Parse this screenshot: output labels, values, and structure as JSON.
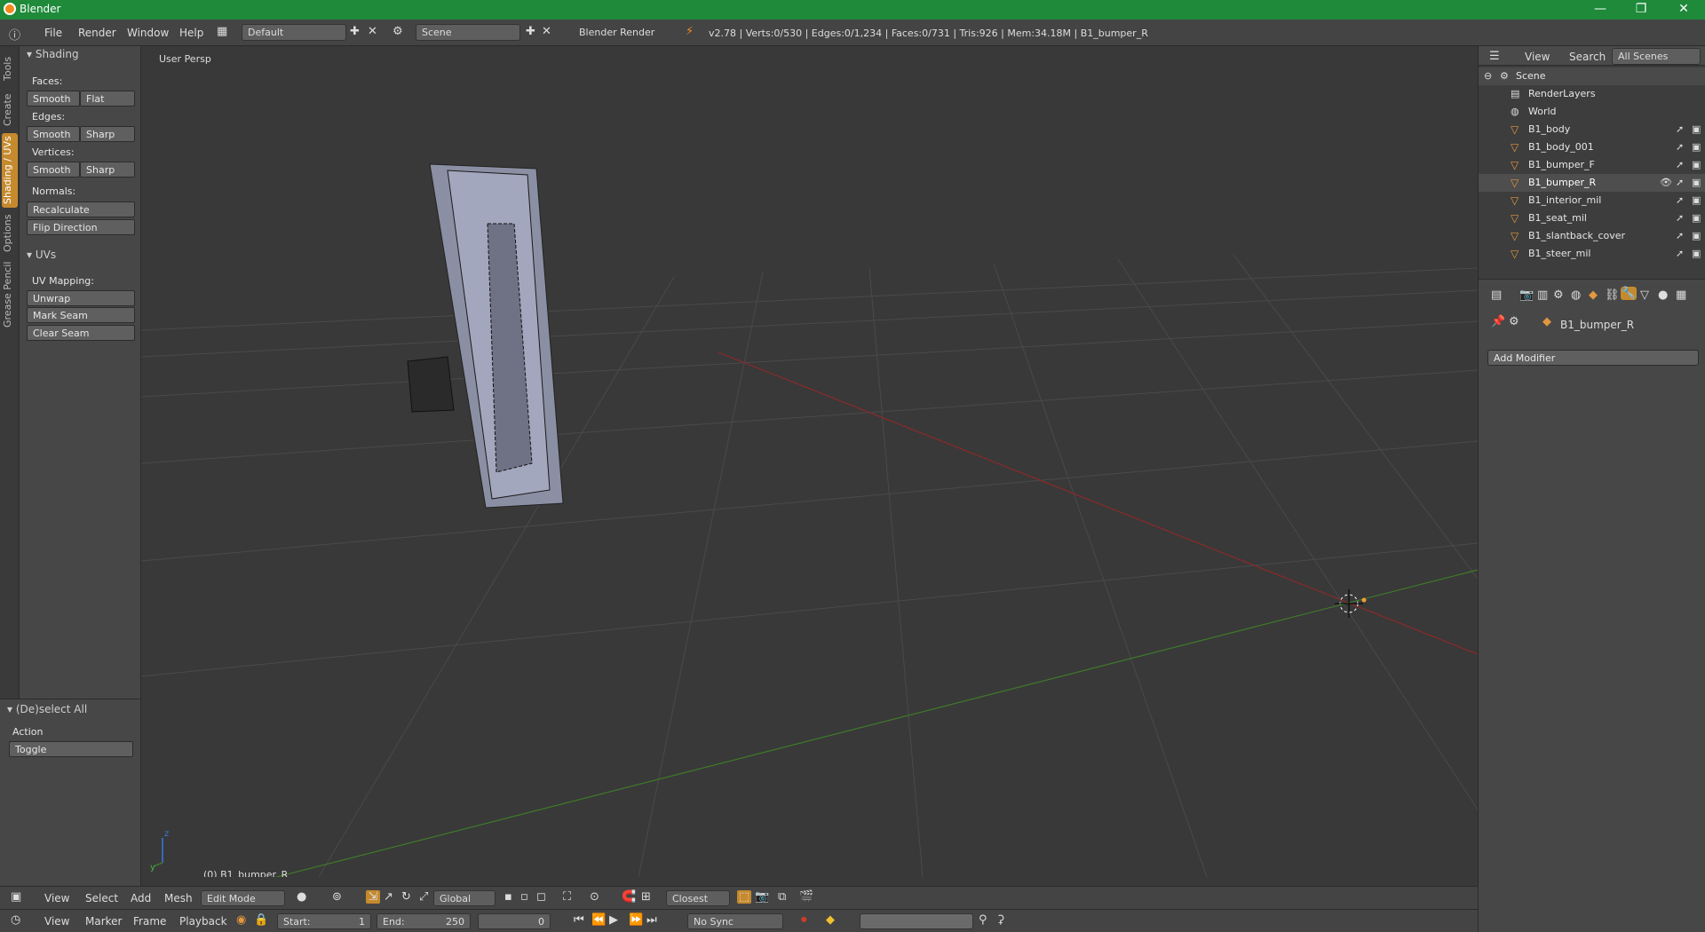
{
  "window": {
    "title": "Blender",
    "minimize": "—",
    "maximize": "❐",
    "close": "✕"
  },
  "info_header": {
    "menu": [
      "File",
      "Render",
      "Window",
      "Help"
    ],
    "layout": "Default",
    "scene": "Scene",
    "engine": "Blender Render",
    "stats": "v2.78 | Verts:0/530 | Edges:0/1,234 | Faces:0/731 | Tris:926 | Mem:34.18M | B1_bumper_R"
  },
  "tool_tabs": [
    "Tools",
    "Create",
    "Shading / UVs",
    "Options",
    "Grease Pencil"
  ],
  "shading_panel": {
    "title": "Shading",
    "faces_label": "Faces:",
    "faces_smooth": "Smooth",
    "faces_flat": "Flat",
    "edges_label": "Edges:",
    "edges_smooth": "Smooth",
    "edges_sharp": "Sharp",
    "vertices_label": "Vertices:",
    "vertices_smooth": "Smooth",
    "vertices_sharp": "Sharp",
    "normals_label": "Normals:",
    "recalculate": "Recalculate",
    "flip_direction": "Flip Direction"
  },
  "uvs_panel": {
    "title": "UVs",
    "mapping_label": "UV Mapping:",
    "unwrap": "Unwrap",
    "mark_seam": "Mark Seam",
    "clear_seam": "Clear Seam"
  },
  "operator_panel": {
    "title": "(De)select All",
    "action_label": "Action",
    "action_value": "Toggle"
  },
  "viewport": {
    "view_label": "User Persp",
    "object_label": "(0) B1_bumper_R"
  },
  "outliner": {
    "view": "View",
    "search": "Search",
    "scene_filter": "All Scenes",
    "items": [
      {
        "name": "Scene"
      },
      {
        "name": "RenderLayers"
      },
      {
        "name": "World"
      },
      {
        "name": "B1_body"
      },
      {
        "name": "B1_body_001"
      },
      {
        "name": "B1_bumper_F"
      },
      {
        "name": "B1_bumper_R"
      },
      {
        "name": "B1_interior_mil"
      },
      {
        "name": "B1_seat_mil"
      },
      {
        "name": "B1_slantback_cover"
      },
      {
        "name": "B1_steer_mil"
      }
    ]
  },
  "properties": {
    "object_name": "B1_bumper_R",
    "add_modifier": "Add Modifier"
  },
  "viewport_header": {
    "menu": [
      "View",
      "Select",
      "Add",
      "Mesh"
    ],
    "mode": "Edit Mode",
    "orientation": "Global",
    "snap_target": "Closest"
  },
  "timeline": {
    "menu": [
      "View",
      "Marker",
      "Frame",
      "Playback"
    ],
    "start_label": "Start:",
    "start": "1",
    "end_label": "End:",
    "end": "250",
    "current": "0",
    "sync": "No Sync"
  },
  "colors": {
    "title_bar": "#1e8a3a",
    "active_tab": "#c58a2e",
    "x_axis": "#8a2a2a",
    "y_axis": "#3f7a2a"
  }
}
